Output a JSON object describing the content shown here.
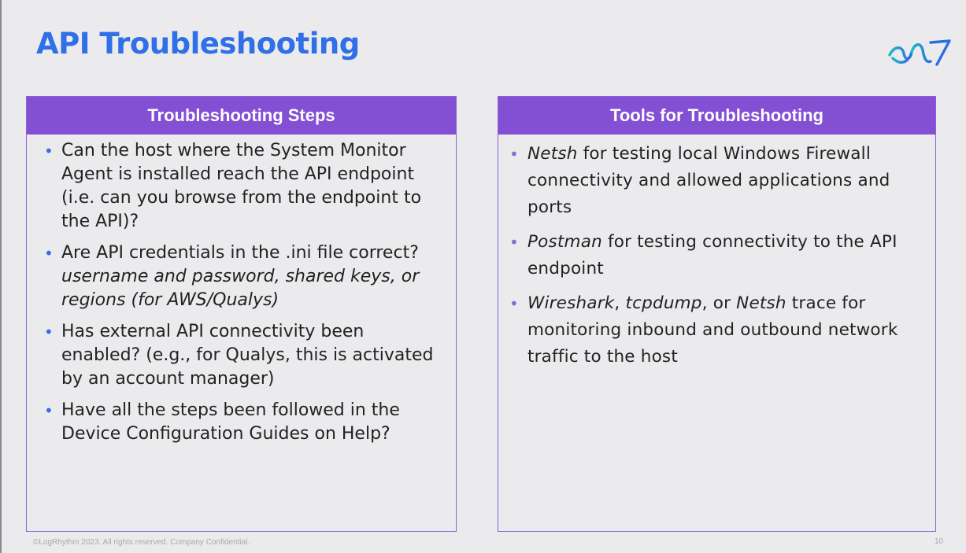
{
  "slide": {
    "title": "API Troubleshooting",
    "footer": "©LogRhythm 2023. All rights reserved. Company Confidential.",
    "page_number": "10",
    "logo_icon": "logrhythm-wave-logo",
    "accent_color": "#2f6fe8",
    "header_color": "#8350d4"
  },
  "left_panel": {
    "header": "Troubleshooting Steps",
    "items": [
      {
        "text": "Can the host where the System Monitor Agent is installed reach the API endpoint (i.e. can you browse from the endpoint to the API)?"
      },
      {
        "text": "Are API credentials in the .ini file correct?",
        "sub": "username and password, shared keys, or regions (for AWS/Qualys)"
      },
      {
        "text": "Has external API connectivity been enabled? (e.g., for Qualys, this is activated by an account manager)"
      },
      {
        "text": "Have all the steps been followed in the Device Configuration Guides on Help?"
      }
    ]
  },
  "right_panel": {
    "header": "Tools for Troubleshooting",
    "items": [
      {
        "tool": "Netsh",
        "rest": " for testing local Windows Firewall connectivity and allowed applications and ports"
      },
      {
        "tool": "Postman",
        "rest": " for testing connectivity to the API endpoint"
      },
      {
        "tool": "Wireshark",
        "mid1": ", ",
        "tool2": "tcpdump",
        "mid2": ", or ",
        "tool3": "Netsh",
        "rest": " trace for monitoring inbound and outbound network traffic to the host"
      }
    ]
  }
}
